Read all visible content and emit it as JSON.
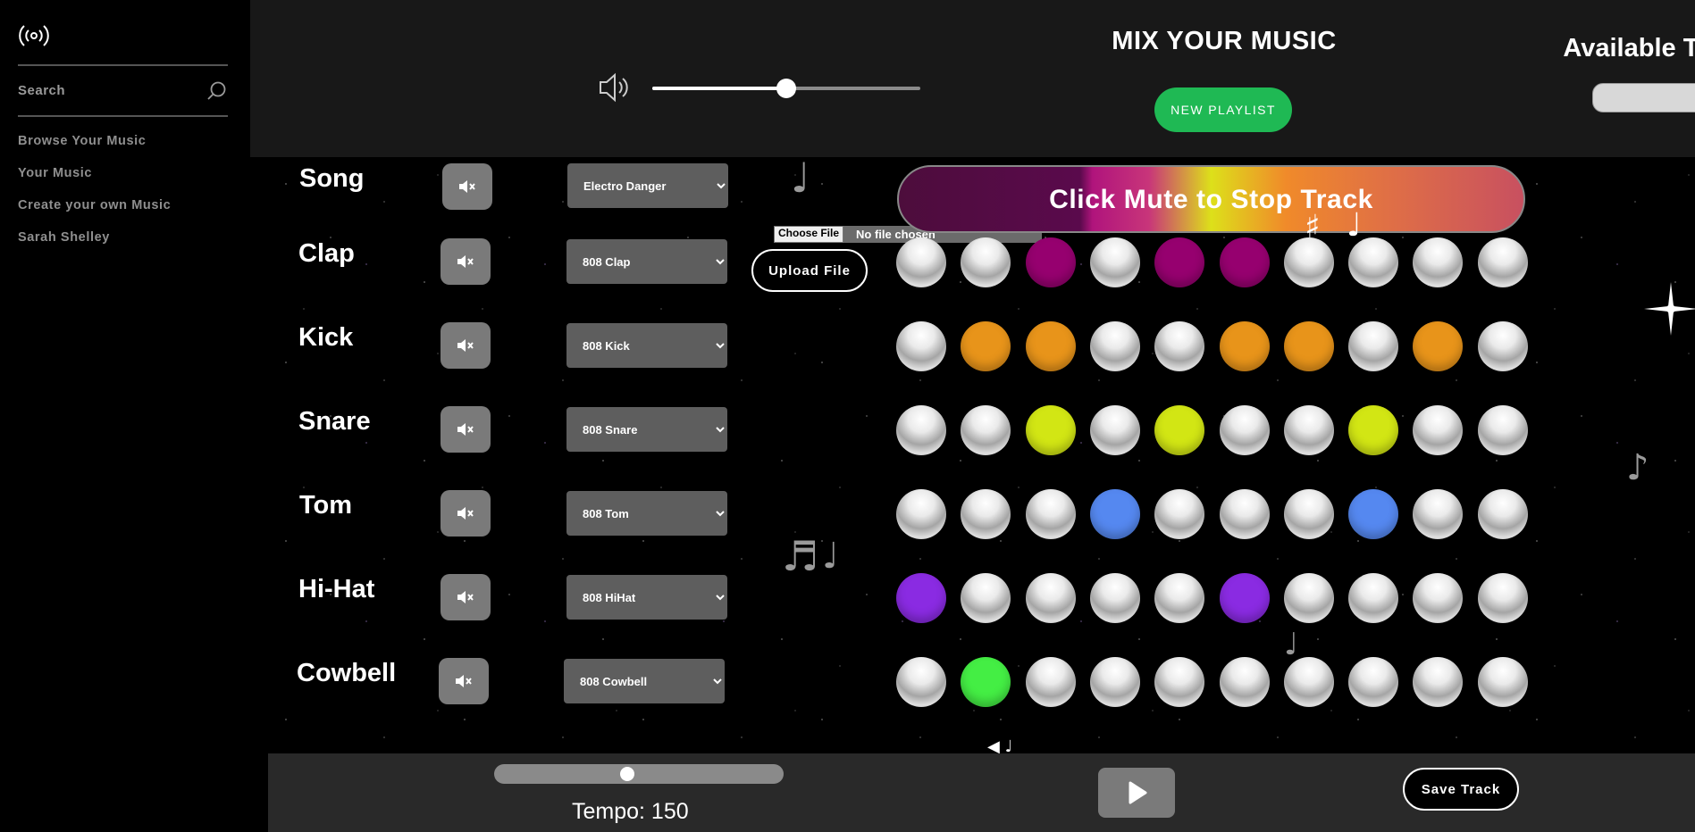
{
  "sidebar": {
    "search": {
      "placeholder": "Search"
    },
    "items": [
      {
        "label": "Browse Your Music"
      },
      {
        "label": "Your Music"
      },
      {
        "label": "Create your own Music"
      },
      {
        "label": "Sarah Shelley"
      }
    ]
  },
  "header": {
    "title": "MIX YOUR MUSIC",
    "new_playlist_label": "NEW PLAYLIST",
    "available_tracks_title": "Available Tracks",
    "available_tracks_value": "",
    "volume_fraction": 0.5
  },
  "song_row": {
    "name": "Song",
    "select_value": "Electro Danger",
    "file_input": {
      "button": "Choose File",
      "status": "No file chosen"
    },
    "upload_label": "Upload File",
    "banner_text": "Click Mute to Stop Track"
  },
  "tracks": [
    {
      "name": "Clap",
      "sound": "808 Clap",
      "color": "#96006f",
      "steps": [
        0,
        0,
        1,
        0,
        1,
        1,
        0,
        0,
        0,
        0
      ]
    },
    {
      "name": "Kick",
      "sound": "808 Kick",
      "color": "#e8941a",
      "steps": [
        0,
        1,
        1,
        0,
        0,
        1,
        1,
        0,
        1,
        0
      ]
    },
    {
      "name": "Snare",
      "sound": "808 Snare",
      "color": "#d2e614",
      "steps": [
        0,
        0,
        1,
        0,
        1,
        0,
        0,
        1,
        0,
        0
      ]
    },
    {
      "name": "Tom",
      "sound": "808 Tom",
      "color": "#5588f0",
      "steps": [
        0,
        0,
        0,
        1,
        0,
        0,
        0,
        1,
        0,
        0
      ]
    },
    {
      "name": "Hi-Hat",
      "sound": "808 HiHat",
      "color": "#8a2be2",
      "steps": [
        1,
        0,
        0,
        0,
        0,
        1,
        0,
        0,
        0,
        0
      ]
    },
    {
      "name": "Cowbell",
      "sound": "808 Cowbell",
      "color": "#44ee44",
      "steps": [
        0,
        1,
        0,
        0,
        0,
        0,
        0,
        0,
        0,
        0
      ]
    }
  ],
  "footer": {
    "tempo_label": "Tempo: 150",
    "tempo_fraction": 0.46,
    "save_label": "Save Track"
  },
  "icons": {
    "logo": "broadcast-icon",
    "search": "search-icon",
    "volume": "speaker-icon",
    "mute": "mute-icon",
    "play": "play-icon"
  }
}
